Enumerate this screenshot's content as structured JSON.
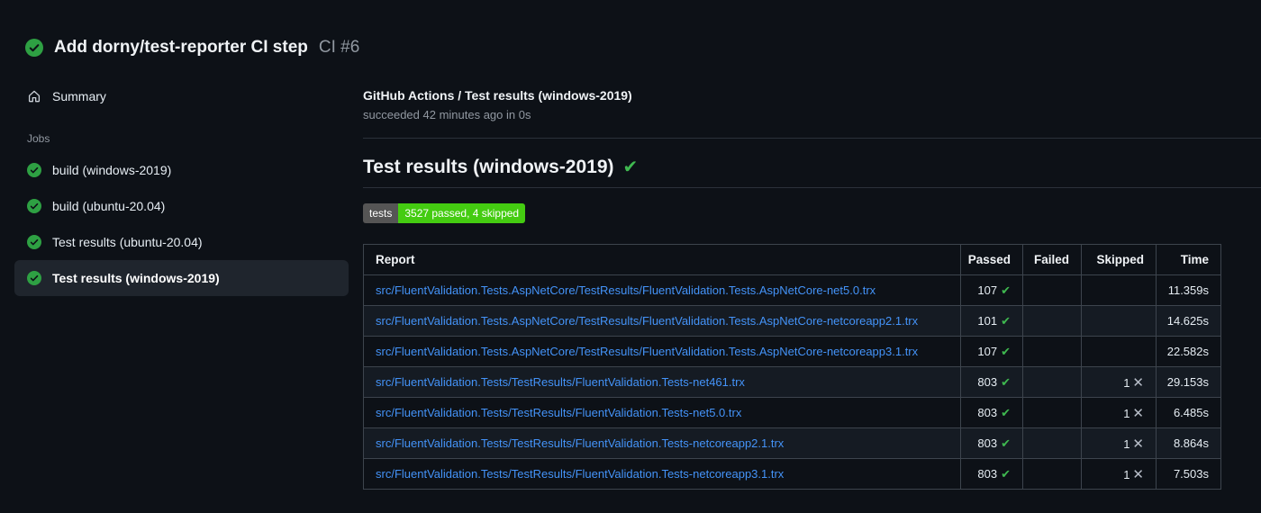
{
  "header": {
    "title": "Add dorny/test-reporter CI step",
    "run_number": "CI #6"
  },
  "sidebar": {
    "summary_label": "Summary",
    "jobs_label": "Jobs",
    "jobs": [
      {
        "label": "build (windows-2019)",
        "selected": false
      },
      {
        "label": "build (ubuntu-20.04)",
        "selected": false
      },
      {
        "label": "Test results (ubuntu-20.04)",
        "selected": false
      },
      {
        "label": "Test results (windows-2019)",
        "selected": true
      }
    ]
  },
  "main": {
    "job_title": "GitHub Actions / Test results (windows-2019)",
    "job_status": "succeeded 42 minutes ago in 0s",
    "heading": "Test results (windows-2019)",
    "heading_check": "✔",
    "badge": {
      "label": "tests",
      "value": "3527 passed, 4 skipped",
      "label_bg": "#555555",
      "value_bg": "#44cc11"
    },
    "table": {
      "headers": [
        "Report",
        "Passed",
        "Failed",
        "Skipped",
        "Time"
      ],
      "rows": [
        {
          "report": "src/FluentValidation.Tests.AspNetCore/TestResults/FluentValidation.Tests.AspNetCore-net5.0.trx",
          "passed": "107",
          "passed_icon": "✔",
          "failed": "",
          "skipped": "",
          "skipped_icon": "",
          "time": "11.359s"
        },
        {
          "report": "src/FluentValidation.Tests.AspNetCore/TestResults/FluentValidation.Tests.AspNetCore-netcoreapp2.1.trx",
          "passed": "101",
          "passed_icon": "✔",
          "failed": "",
          "skipped": "",
          "skipped_icon": "",
          "time": "14.625s"
        },
        {
          "report": "src/FluentValidation.Tests.AspNetCore/TestResults/FluentValidation.Tests.AspNetCore-netcoreapp3.1.trx",
          "passed": "107",
          "passed_icon": "✔",
          "failed": "",
          "skipped": "",
          "skipped_icon": "",
          "time": "22.582s"
        },
        {
          "report": "src/FluentValidation.Tests/TestResults/FluentValidation.Tests-net461.trx",
          "passed": "803",
          "passed_icon": "✔",
          "failed": "",
          "skipped": "1",
          "skipped_icon": "✕",
          "time": "29.153s"
        },
        {
          "report": "src/FluentValidation.Tests/TestResults/FluentValidation.Tests-net5.0.trx",
          "passed": "803",
          "passed_icon": "✔",
          "failed": "",
          "skipped": "1",
          "skipped_icon": "✕",
          "time": "6.485s"
        },
        {
          "report": "src/FluentValidation.Tests/TestResults/FluentValidation.Tests-netcoreapp2.1.trx",
          "passed": "803",
          "passed_icon": "✔",
          "failed": "",
          "skipped": "1",
          "skipped_icon": "✕",
          "time": "8.864s"
        },
        {
          "report": "src/FluentValidation.Tests/TestResults/FluentValidation.Tests-netcoreapp3.1.trx",
          "passed": "803",
          "passed_icon": "✔",
          "failed": "",
          "skipped": "1",
          "skipped_icon": "✕",
          "time": "7.503s"
        }
      ]
    }
  },
  "colors": {
    "background": "#0d1117",
    "success_circle": "#2ea043",
    "success_check": "#3fb950",
    "link": "#4493f8",
    "muted": "#9198a1",
    "table_border": "#3d444d",
    "row_alt": "#151b23",
    "selected_item_bg": "#1f252d"
  }
}
